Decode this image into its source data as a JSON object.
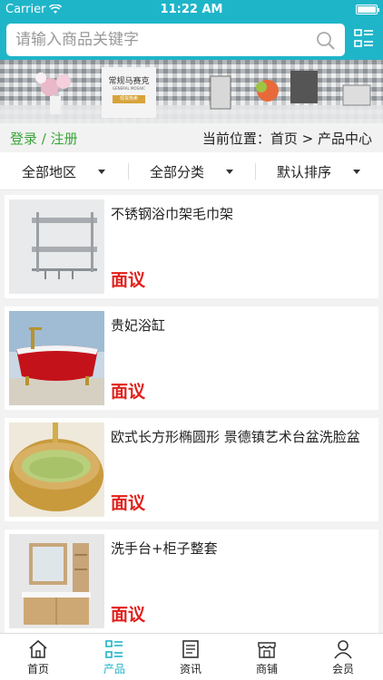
{
  "status_bar": {
    "carrier": "Carrier",
    "time": "11:22 AM"
  },
  "search": {
    "placeholder": "请输入商品关键字"
  },
  "banner": {
    "brand_title": "常规马赛克",
    "brand_subtitle": "GENERAL MOSAIC",
    "brand_button": "现货热卖"
  },
  "breadcrumb": {
    "login": "登录",
    "separator": "/",
    "register": "注册",
    "position": "当前位置：首页 > 产品中心"
  },
  "filters": [
    {
      "label": "全部地区"
    },
    {
      "label": "全部分类"
    },
    {
      "label": "默认排序"
    }
  ],
  "products": [
    {
      "title": "不锈钢浴巾架毛巾架",
      "price": "面议"
    },
    {
      "title": "贵妃浴缸",
      "price": "面议"
    },
    {
      "title": "欧式长方形椭圆形 景德镇艺术台盆洗脸盆",
      "price": "面议"
    },
    {
      "title": "洗手台+柜子整套",
      "price": "面议"
    }
  ],
  "tabbar": [
    {
      "label": "首页",
      "icon": "home-icon"
    },
    {
      "label": "产品",
      "icon": "product-grid-icon"
    },
    {
      "label": "资讯",
      "icon": "news-icon"
    },
    {
      "label": "商铺",
      "icon": "shop-icon"
    },
    {
      "label": "会员",
      "icon": "member-icon"
    }
  ],
  "colors": {
    "primary": "#1fb5c9",
    "price": "#e0201c",
    "login": "#3aa53a"
  }
}
